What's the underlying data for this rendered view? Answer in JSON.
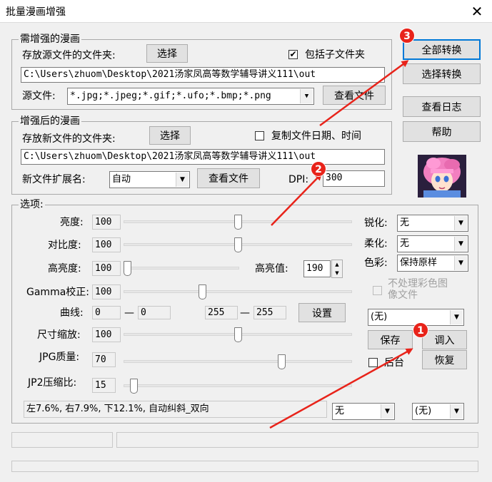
{
  "window": {
    "title": "批量漫画增强",
    "close": "✕"
  },
  "source_group": {
    "label": "需增强的漫画",
    "folder_label": "存放源文件的文件夹:",
    "select_button": "选择",
    "include_subfolders_label": "包括子文件夹",
    "include_subfolders_checked": true,
    "folder_path": "C:\\Users\\zhuom\\Desktop\\2021汤家凤高等数学辅导讲义111\\out",
    "file_types_label": "源文件:",
    "file_types_value": "*.jpg;*.jpeg;*.gif;*.ufo;*.bmp;*.png",
    "view_files_button": "查看文件"
  },
  "target_group": {
    "label": "增强后的漫画",
    "folder_label": "存放新文件的文件夹:",
    "select_button": "选择",
    "copy_date_label": "复制文件日期、时间",
    "copy_date_checked": false,
    "folder_path": "C:\\Users\\zhuom\\Desktop\\2021汤家凤高等数学辅导讲义111\\out",
    "ext_label": "新文件扩展名:",
    "ext_value": "自动",
    "view_files_button": "查看文件",
    "dpi_label": "DPI:",
    "dpi_value": "300"
  },
  "side_buttons": {
    "convert_all": "全部转换",
    "convert_selected": "选择转换",
    "view_log": "查看日志",
    "help": "帮助"
  },
  "options": {
    "label": "选项:",
    "brightness_label": "亮度:",
    "brightness_value": "100",
    "brightness_level": 0.5,
    "contrast_label": "对比度:",
    "contrast_value": "100",
    "contrast_level": 0.5,
    "highlight_label": "高亮度:",
    "highlight_value": "100",
    "highlight_level": 0.0,
    "highlight_threshold_label": "高亮值:",
    "highlight_threshold_value": "190",
    "gamma_label": "Gamma校正:",
    "gamma_value": "100",
    "gamma_level": 0.34,
    "curve_label": "曲线:",
    "curve_a": "0",
    "curve_b": "0",
    "curve_c": "255",
    "curve_d": "255",
    "curve_dash": "—",
    "curve_settings_button": "设置",
    "resize_label": "尺寸缩放:",
    "resize_value": "100",
    "resize_level": 0.5,
    "jpg_quality_label": "JPG质量:",
    "jpg_quality_value": "70",
    "jpg_quality_level": 0.7,
    "jp2_label": "JP2压缩比:",
    "jp2_value": "15",
    "jp2_level": 0.03,
    "sharpen_label": "锐化:",
    "sharpen_value": "无",
    "soften_label": "柔化:",
    "soften_value": "无",
    "color_label": "色彩:",
    "color_value": "保持原样",
    "skip_color_label_1": "不处理彩色图",
    "skip_color_label_2": "像文件",
    "preset_value": "(无)",
    "save_button": "保存",
    "load_button": "调入",
    "restore_button": "恢复",
    "after_label": "后台",
    "crop_status": "左7.6%, 右7.9%, 下12.1%, 自动纠斜_双向",
    "bottom_combo_1": "无",
    "bottom_combo_2": "(无)"
  },
  "annotations": {
    "badge_1": "1",
    "badge_2": "2",
    "badge_3": "3",
    "color": "#e8231a"
  }
}
